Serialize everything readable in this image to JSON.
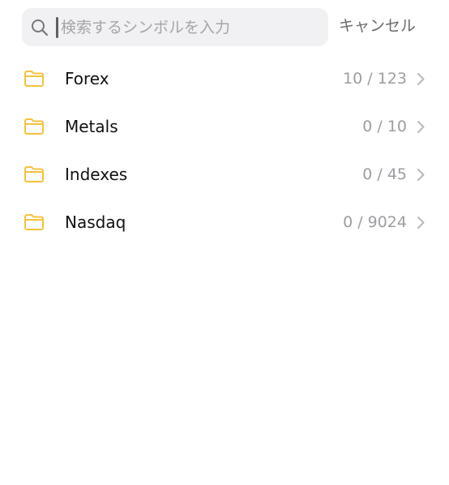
{
  "search": {
    "placeholder": "検索するシンボルを入力",
    "value": "",
    "cancel_label": "キャンセル"
  },
  "groups": [
    {
      "label": "Forex",
      "count": "10 / 123",
      "icon": "folder-icon"
    },
    {
      "label": "Metals",
      "count": "0 / 10",
      "icon": "folder-icon"
    },
    {
      "label": "Indexes",
      "count": "0 / 45",
      "icon": "folder-icon"
    },
    {
      "label": "Nasdaq",
      "count": "0 / 9024",
      "icon": "folder-icon"
    }
  ],
  "colors": {
    "folder": "#f4c33d",
    "chevron": "#b8b8bd",
    "search_bg": "#f1f1f3"
  }
}
